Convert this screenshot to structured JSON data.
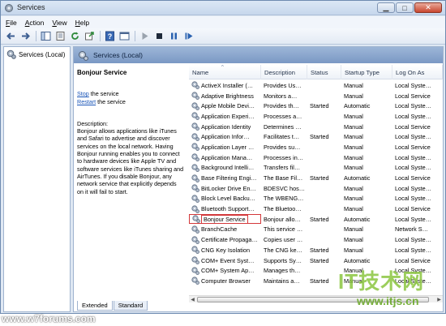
{
  "window": {
    "title": "Services"
  },
  "menu": [
    {
      "label": "File",
      "accel": "F",
      "rest": "ile"
    },
    {
      "label": "Action",
      "accel": "A",
      "rest": "ction"
    },
    {
      "label": "View",
      "accel": "V",
      "rest": "iew"
    },
    {
      "label": "Help",
      "accel": "H",
      "rest": "elp"
    }
  ],
  "toolbar": {
    "icons": [
      "back-arrow-icon",
      "forward-arrow-icon",
      "show-tree-icon",
      "properties-icon",
      "refresh-icon",
      "export-icon",
      "help-icon",
      "console-icon",
      "play-icon",
      "stop-icon",
      "pause-icon",
      "restart-icon"
    ]
  },
  "tree": {
    "root_label": "Services (Local)"
  },
  "pane": {
    "header": "Services (Local)"
  },
  "details": {
    "service_title": "Bonjour Service",
    "stop_link": "Stop",
    "stop_rest": " the service",
    "restart_link": "Restart",
    "restart_rest": " the service",
    "description_label": "Description:",
    "description_body": "Bonjour allows applications like iTunes and Safari to advertise and discover services on the local network.  Having Bonjour running enables you to connect to hardware devices like Apple TV and software services like iTunes sharing and AirTunes. If you disable Bonjour, any network service that explicitly depends on it will fail to start."
  },
  "table": {
    "headers": {
      "name": "Name",
      "description": "Description",
      "status": "Status",
      "startup": "Startup Type",
      "logon": "Log On As"
    },
    "rows": [
      {
        "name": "ActiveX Installer (…",
        "description": "Provides Us…",
        "status": "",
        "startup": "Manual",
        "logon": "Local Syste…"
      },
      {
        "name": "Adaptive Brightness",
        "description": "Monitors a…",
        "status": "",
        "startup": "Manual",
        "logon": "Local Service"
      },
      {
        "name": "Apple Mobile Devi…",
        "description": "Provides th…",
        "status": "Started",
        "startup": "Automatic",
        "logon": "Local Syste…"
      },
      {
        "name": "Application Experi…",
        "description": "Processes a…",
        "status": "",
        "startup": "Manual",
        "logon": "Local Syste…"
      },
      {
        "name": "Application Identity",
        "description": "Determines …",
        "status": "",
        "startup": "Manual",
        "logon": "Local Service"
      },
      {
        "name": "Application Infor…",
        "description": "Facilitates t…",
        "status": "Started",
        "startup": "Manual",
        "logon": "Local Syste…"
      },
      {
        "name": "Application Layer …",
        "description": "Provides su…",
        "status": "",
        "startup": "Manual",
        "logon": "Local Service"
      },
      {
        "name": "Application Mana…",
        "description": "Processes in…",
        "status": "",
        "startup": "Manual",
        "logon": "Local Syste…"
      },
      {
        "name": "Background Intelli…",
        "description": "Transfers fil…",
        "status": "",
        "startup": "Manual",
        "logon": "Local Syste…"
      },
      {
        "name": "Base Filtering Engi…",
        "description": "The Base Fil…",
        "status": "Started",
        "startup": "Automatic",
        "logon": "Local Service"
      },
      {
        "name": "BitLocker Drive En…",
        "description": "BDESVC hos…",
        "status": "",
        "startup": "Manual",
        "logon": "Local Syste…"
      },
      {
        "name": "Block Level Backu…",
        "description": "The WBENG…",
        "status": "",
        "startup": "Manual",
        "logon": "Local Syste…"
      },
      {
        "name": "Bluetooth Support…",
        "description": "The Bluetoo…",
        "status": "",
        "startup": "Manual",
        "logon": "Local Service"
      },
      {
        "name": "Bonjour Service",
        "description": "Bonjour allo…",
        "status": "Started",
        "startup": "Automatic",
        "logon": "Local Syste…",
        "selected": true
      },
      {
        "name": "BranchCache",
        "description": "This service …",
        "status": "",
        "startup": "Manual",
        "logon": "Network S…"
      },
      {
        "name": "Certificate Propaga…",
        "description": "Copies user …",
        "status": "",
        "startup": "Manual",
        "logon": "Local Syste…"
      },
      {
        "name": "CNG Key Isolation",
        "description": "The CNG ke…",
        "status": "Started",
        "startup": "Manual",
        "logon": "Local Syste…"
      },
      {
        "name": "COM+ Event Syst…",
        "description": "Supports Sy…",
        "status": "Started",
        "startup": "Automatic",
        "logon": "Local Service"
      },
      {
        "name": "COM+ System Ap…",
        "description": "Manages th…",
        "status": "",
        "startup": "Manual",
        "logon": "Local Syste…"
      },
      {
        "name": "Computer Browser",
        "description": "Maintains a…",
        "status": "Started",
        "startup": "Manual",
        "logon": "Local Syste…"
      }
    ]
  },
  "tabs": [
    {
      "label": "Extended"
    },
    {
      "label": "Standard"
    }
  ],
  "watermarks": {
    "left": "www.w7forums.com",
    "right_logo": "IT技术网",
    "right_url": "www.itjs.cn"
  }
}
